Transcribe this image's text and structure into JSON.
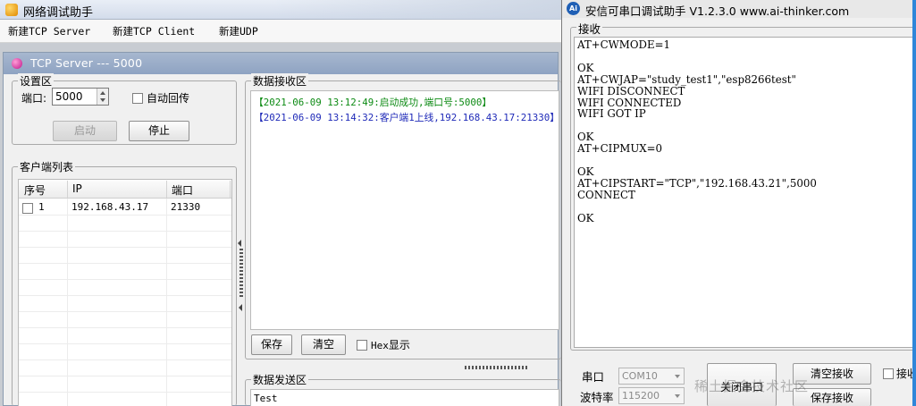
{
  "left_window": {
    "title": "网络调试助手",
    "menu": [
      "新建TCP Server",
      "新建TCP Client",
      "新建UDP"
    ],
    "server_window_title": "TCP Server --- 5000",
    "settings": {
      "legend": "设置区",
      "port_label": "端口:",
      "port_value": "5000",
      "auto_reply_label": "自动回传",
      "start_label": "启动",
      "stop_label": "停止"
    },
    "clients": {
      "legend": "客户端列表",
      "columns": [
        "序号",
        "IP",
        "端口"
      ],
      "rows": [
        {
          "index": "1",
          "ip": "192.168.43.17",
          "port": "21330"
        }
      ]
    },
    "receive": {
      "legend": "数据接收区",
      "lines": [
        "【2021-06-09 13:12:49:启动成功,端口号:5000】",
        "【2021-06-09 13:14:32:客户端1上线,192.168.43.17:21330】"
      ],
      "save_label": "保存",
      "clear_label": "清空",
      "hex_prefix": "Hex",
      "hex_suffix": "显示"
    },
    "send": {
      "legend": "数据发送区",
      "text": "Test"
    }
  },
  "right_window": {
    "title": "安信可串口调试助手 V1.2.3.0    www.ai-thinker.com",
    "icon_text": "Ai",
    "receive_legend": "接收",
    "receive_text": "AT+CWMODE=1\n\nOK\nAT+CWJAP=\"study_test1\",\"esp8266test\"\nWIFI DISCONNECT\nWIFI CONNECTED\nWIFI GOT IP\n\nOK\nAT+CIPMUX=0\n\nOK\nAT+CIPSTART=\"TCP\",\"192.168.43.21\",5000\nCONNECT\n\nOK",
    "port_label": "串口",
    "port_value": "COM10",
    "baud_label": "波特率",
    "baud_value": "115200",
    "close_port_label": "关闭串口",
    "clear_rx_label": "清空接收",
    "save_rx_label": "保存接收",
    "rx_check_label": "接收",
    "watermark": "稀土掘金技术社区"
  },
  "colors": {
    "success_line": "#0c8a13",
    "online_line": "#1f2ab8",
    "mdi_title": "#8ea3c2",
    "accent": "#2f86d9"
  }
}
